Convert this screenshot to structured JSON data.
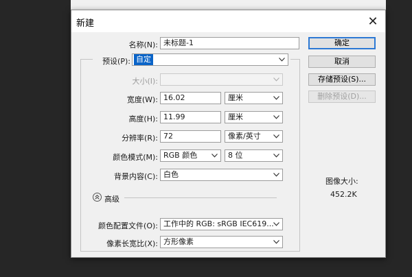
{
  "dialog": {
    "title": "新建",
    "close_glyph": "✕"
  },
  "form": {
    "name_label": "名称(N):",
    "name_value": "未标题-1",
    "preset_label": "预设(P):",
    "preset_value": "自定",
    "size_label": "大小(I):",
    "size_value": "",
    "width_label": "宽度(W):",
    "width_value": "16.02",
    "width_unit": "厘米",
    "height_label": "高度(H):",
    "height_value": "11.99",
    "height_unit": "厘米",
    "resolution_label": "分辨率(R):",
    "resolution_value": "72",
    "resolution_unit": "像素/英寸",
    "color_mode_label": "颜色模式(M):",
    "color_mode_value": "RGB 颜色",
    "bit_depth_value": "8 位",
    "background_label": "背景内容(C):",
    "background_value": "白色",
    "advanced_label": "高级",
    "color_profile_label": "颜色配置文件(O):",
    "color_profile_value": "工作中的 RGB: sRGB IEC619...",
    "pixel_aspect_label": "像素长宽比(X):",
    "pixel_aspect_value": "方形像素"
  },
  "buttons": {
    "ok": "确定",
    "cancel": "取消",
    "save_preset": "存储预设(S)...",
    "delete_preset": "删除预设(D)..."
  },
  "image_size": {
    "title": "图像大小:",
    "value": "452.2K"
  },
  "icons": {
    "close": "close-icon",
    "chevron": "chevron-down-icon",
    "advanced": "chevron-up-double-icon"
  }
}
